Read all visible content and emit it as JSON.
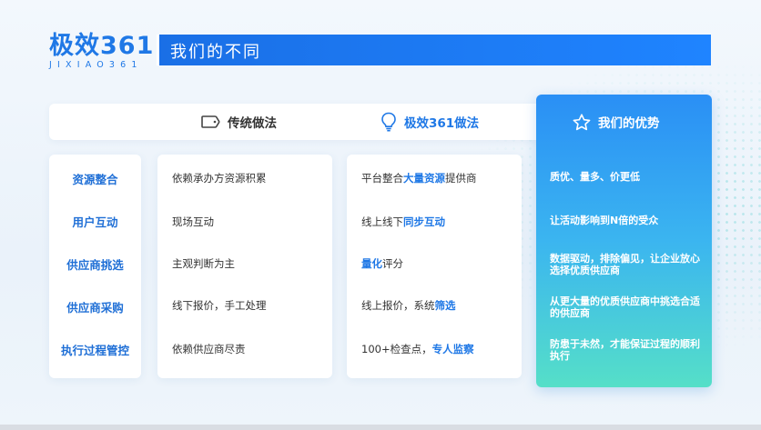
{
  "logo": {
    "main": "极效361",
    "sub": "JIXIAO361"
  },
  "title": "我们的不同",
  "columns": {
    "traditional": {
      "label": "传统做法",
      "icon": "tag-icon"
    },
    "jixiao": {
      "label": "极效361做法",
      "icon": "lightbulb-icon"
    },
    "advantage": {
      "label": "我们的优势",
      "icon": "star-icon"
    }
  },
  "rows": [
    {
      "category": "资源整合",
      "traditional": "依赖承办方资源积累",
      "jixiao": {
        "pre": "平台整合",
        "hl": "大量资源",
        "post": "提供商"
      },
      "advantage": "质优、量多、价更低"
    },
    {
      "category": "用户互动",
      "traditional": "现场互动",
      "jixiao": {
        "pre": "线上线下",
        "hl": "同步互动",
        "post": ""
      },
      "advantage": "让活动影响到N倍的受众"
    },
    {
      "category": "供应商挑选",
      "traditional": "主观判断为主",
      "jixiao": {
        "pre": "",
        "hl": "量化",
        "post": "评分"
      },
      "advantage": "数据驱动，排除偏见，让企业放心选择优质供应商"
    },
    {
      "category": "供应商采购",
      "traditional": "线下报价，手工处理",
      "jixiao": {
        "pre": "线上报价，系统",
        "hl": "筛选",
        "post": ""
      },
      "advantage": "从更大量的优质供应商中挑选合适的供应商"
    },
    {
      "category": "执行过程管控",
      "traditional": "依赖供应商尽责",
      "jixiao": {
        "pre": "100+检查点，",
        "hl": "专人监察",
        "post": ""
      },
      "advantage": "防患于未然，才能保证过程的顺利执行"
    }
  ],
  "colors": {
    "accent": "#1f78e6",
    "gradient_top": "#2a8ff5",
    "gradient_bottom": "#55dfc8"
  }
}
